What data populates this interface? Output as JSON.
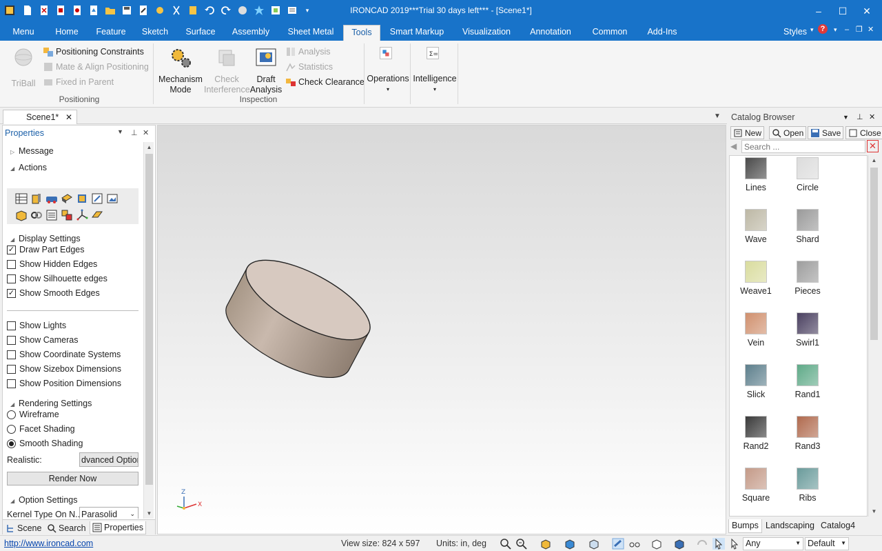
{
  "window": {
    "title": "IRONCAD 2019***Trial 30 days left*** - [Scene1*]",
    "minimize": "–",
    "maximize": "☐",
    "close": "✕"
  },
  "ribbon_tabs": [
    "Menu",
    "Home",
    "Feature",
    "Sketch",
    "Surface",
    "Assembly",
    "Sheet Metal",
    "Tools",
    "Smart Markup",
    "Visualization",
    "Annotation",
    "Common",
    "Add-Ins"
  ],
  "active_tab": "Tools",
  "styles_label": "Styles",
  "ribbon": {
    "positioning": {
      "triball": "TriBall",
      "positioning_constraints": "Positioning Constraints",
      "mate_align": "Mate & Align Positioning",
      "fixed_in_parent": "Fixed in Parent",
      "label": "Positioning"
    },
    "inspection": {
      "mechanism_mode_1": "Mechanism",
      "mechanism_mode_2": "Mode",
      "check_interference_1": "Check",
      "check_interference_2": "Interference",
      "draft_analysis_1": "Draft",
      "draft_analysis_2": "Analysis",
      "analysis": "Analysis",
      "statistics": "Statistics",
      "check_clearance": "Check Clearance",
      "label": "Inspection"
    },
    "operations": "Operations",
    "intelligence": "Intelligence"
  },
  "doc_tab": "Scene1*",
  "properties": {
    "title": "Properties",
    "message": "Message",
    "actions": "Actions",
    "display_settings": "Display Settings",
    "draw_part_edges": "Draw Part Edges",
    "show_hidden_edges": "Show Hidden Edges",
    "show_silhouette_edges": "Show Silhouette edges",
    "show_smooth_edges": "Show Smooth Edges",
    "show_lights": "Show Lights",
    "show_cameras": "Show Cameras",
    "show_coordinate_systems": "Show Coordinate Systems",
    "show_sizebox_dimensions": "Show Sizebox Dimensions",
    "show_position_dimensions": "Show Position Dimensions",
    "rendering_settings": "Rendering Settings",
    "wireframe": "Wireframe",
    "facet_shading": "Facet Shading",
    "smooth_shading": "Smooth Shading",
    "realistic_label": "Realistic:",
    "advanced_options": "dvanced Optior",
    "render_now": "Render Now",
    "option_settings": "Option Settings",
    "kernel_type_label": "Kernel Type On N...",
    "kernel_type_value": "Parasolid",
    "bottom_tabs": [
      "Scene",
      "Search",
      "Properties"
    ]
  },
  "axis": {
    "z": "Z",
    "x": "X"
  },
  "catalog": {
    "title": "Catalog Browser",
    "new": "New",
    "open": "Open",
    "save": "Save",
    "close": "Close",
    "search_placeholder": "Search ...",
    "items": [
      {
        "name": "Lines",
        "color": "#4a4a4a"
      },
      {
        "name": "Circle",
        "color": "#dcdcdc"
      },
      {
        "name": "Wave",
        "color": "#bdb8a5"
      },
      {
        "name": "Shard",
        "color": "#9a9a9a"
      },
      {
        "name": "Weave1",
        "color": "#d9dc9e"
      },
      {
        "name": "Pieces",
        "color": "#9d9d9d"
      },
      {
        "name": "Vein",
        "color": "#d0906e"
      },
      {
        "name": "Swirl1",
        "color": "#4a4060"
      },
      {
        "name": "Slick",
        "color": "#5d7f8c"
      },
      {
        "name": "Rand1",
        "color": "#5faa88"
      },
      {
        "name": "Rand2",
        "color": "#3a3a3a"
      },
      {
        "name": "Rand3",
        "color": "#b06a4e"
      },
      {
        "name": "Square",
        "color": "#c49a88"
      },
      {
        "name": "Ribs",
        "color": "#6a9b9b"
      }
    ],
    "bottom_tabs": [
      "Bumps",
      "Landscaping",
      "Catalog4"
    ]
  },
  "status": {
    "link": "http://www.ironcad.com",
    "view_size": "View size:  824 x  597",
    "units": "Units: in, deg",
    "filter": "Any",
    "style": "Default"
  },
  "colors": {
    "accent": "#1873c9",
    "part": "#b3a499"
  }
}
